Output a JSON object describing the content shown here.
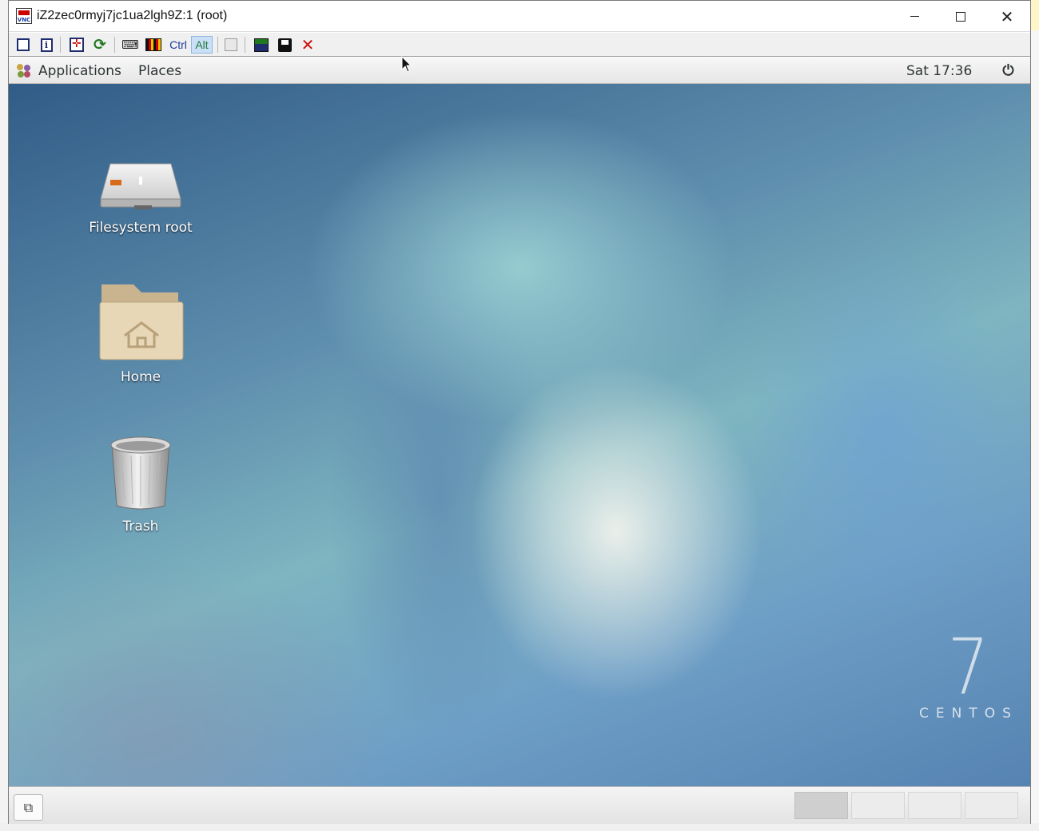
{
  "window": {
    "title": "iZ2zec0rmyj7jc1ua2lgh9Z:1 (root)",
    "app_icon_label": "VNC",
    "controls": {
      "minimize": "minimize-icon",
      "maximize": "maximize-icon",
      "close": "close-icon"
    }
  },
  "toolbar": {
    "buttons": [
      {
        "name": "options-icon"
      },
      {
        "name": "connection-info-icon"
      },
      {
        "name": "fullscreen-icon"
      },
      {
        "name": "refresh-icon"
      },
      {
        "name": "send-keys-icon"
      },
      {
        "name": "record-icon"
      },
      {
        "name": "ctrl-key",
        "label": "Ctrl"
      },
      {
        "name": "alt-key",
        "label": "Alt"
      },
      {
        "name": "clipboard-icon"
      },
      {
        "name": "transfer-icon"
      },
      {
        "name": "save-icon"
      },
      {
        "name": "disconnect-icon"
      }
    ]
  },
  "panel": {
    "applications": "Applications",
    "places": "Places",
    "clock": "Sat 17:36",
    "power_icon": "power-icon"
  },
  "desktop": {
    "icons": [
      {
        "name": "filesystem-root",
        "label": "Filesystem root",
        "icon": "drive-icon"
      },
      {
        "name": "home",
        "label": "Home",
        "icon": "home-folder-icon"
      },
      {
        "name": "trash",
        "label": "Trash",
        "icon": "trash-icon"
      }
    ],
    "logo": {
      "number": "7",
      "word": "CENTOS"
    }
  },
  "taskbar": {
    "show_desktop_icon": "show-desktop-icon",
    "workspaces": 4,
    "active_workspace": 1
  },
  "colors": {
    "panel_text": "#2e3436",
    "desktop_label": "#ffffff",
    "disconnect_red": "#d01010"
  }
}
